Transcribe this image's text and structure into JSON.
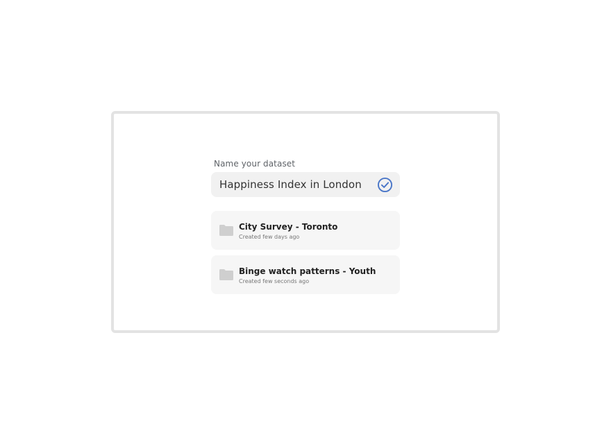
{
  "dialog": {
    "field_label": "Name your dataset",
    "dataset_name": "Happiness Index in London",
    "confirm_icon": "check-circle-icon",
    "accent_color": "#4a76c8"
  },
  "datasets": [
    {
      "icon": "folder-icon",
      "title": "City Survey - Toronto",
      "meta": "Created few days ago"
    },
    {
      "icon": "folder-icon",
      "title": "Binge watch patterns - Youth",
      "meta": "Created few seconds ago"
    }
  ]
}
